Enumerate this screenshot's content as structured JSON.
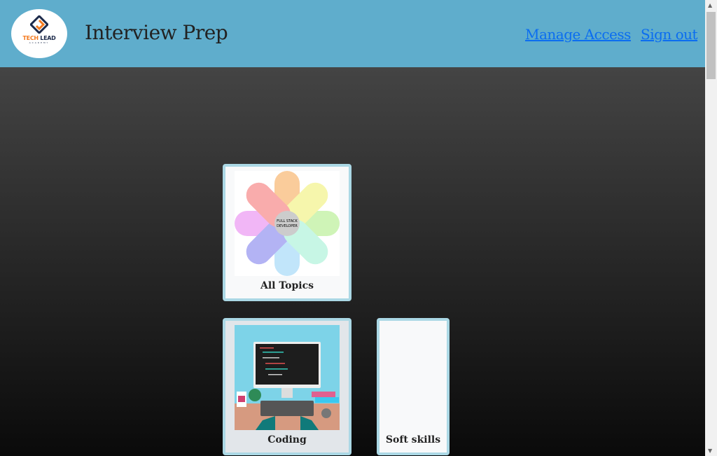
{
  "header": {
    "logo_text": "TECH LEAD",
    "logo_sub": "ACADEMY",
    "title": "Interview Prep",
    "links": [
      {
        "label": "Manage Access"
      },
      {
        "label": "Sign out"
      }
    ]
  },
  "cards": [
    {
      "label": "All Topics",
      "image": "full-stack-web-developer-flower-diagram"
    },
    {
      "label": "Coding",
      "image": "developer-at-computer-illustration"
    },
    {
      "label": "Soft skills",
      "image": ""
    }
  ],
  "colors": {
    "header": "#5fadcc",
    "card_border": "#abd8e5",
    "link": "#0b6df0"
  }
}
